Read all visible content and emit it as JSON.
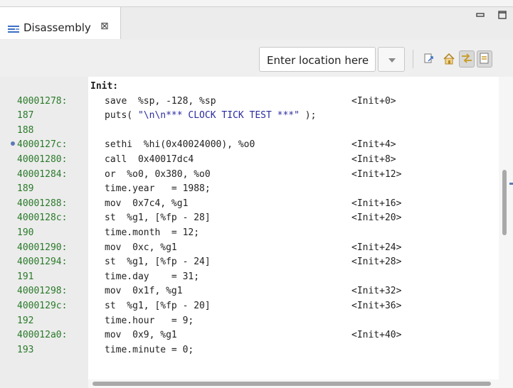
{
  "tab": {
    "title": "Disassembly",
    "close_glyph": "⊠",
    "icon": "disassembly-icon"
  },
  "view_buttons": {
    "minimize": "▭",
    "maximize": "▭"
  },
  "toolbar": {
    "location_placeholder": "Enter location here",
    "buttons": [
      "go-to-address-icon",
      "home-icon",
      "link-with-debug-icon",
      "show-source-icon"
    ]
  },
  "lines": [
    {
      "addr": "",
      "code": "Init:",
      "kind": "label"
    },
    {
      "addr": "40001278:",
      "code": "save  %sp, -128, %sp",
      "offset": "<Init+0>"
    },
    {
      "addr": "187",
      "code_prefix": "puts( ",
      "code_str": "\"\\n\\n*** CLOCK TICK TEST ***\"",
      "code_suffix": " );",
      "kind": "source"
    },
    {
      "addr": "188",
      "code": ""
    },
    {
      "addr": "4000127c:",
      "code": "sethi  %hi(0x40024000), %o0",
      "offset": "<Init+4>",
      "breakpoint": true
    },
    {
      "addr": "40001280:",
      "code": "call  0x40017dc4",
      "offset": "<Init+8>"
    },
    {
      "addr": "40001284:",
      "code": "or  %o0, 0x380, %o0",
      "offset": "<Init+12>"
    },
    {
      "addr": "189",
      "code": "time.year   = 1988;"
    },
    {
      "addr": "40001288:",
      "code": "mov  0x7c4, %g1",
      "offset": "<Init+16>"
    },
    {
      "addr": "4000128c:",
      "code": "st  %g1, [%fp - 28]",
      "offset": "<Init+20>"
    },
    {
      "addr": "190",
      "code": "time.month  = 12;"
    },
    {
      "addr": "40001290:",
      "code": "mov  0xc, %g1",
      "offset": "<Init+24>"
    },
    {
      "addr": "40001294:",
      "code": "st  %g1, [%fp - 24]",
      "offset": "<Init+28>"
    },
    {
      "addr": "191",
      "code": "time.day    = 31;"
    },
    {
      "addr": "40001298:",
      "code": "mov  0x1f, %g1",
      "offset": "<Init+32>"
    },
    {
      "addr": "4000129c:",
      "code": "st  %g1, [%fp - 20]",
      "offset": "<Init+36>"
    },
    {
      "addr": "192",
      "code": "time.hour   = 9;"
    },
    {
      "addr": "400012a0:",
      "code": "mov  0x9, %g1",
      "offset": "<Init+40>"
    },
    {
      "addr": "193",
      "code": "time.minute = 0;"
    }
  ],
  "colors": {
    "address": "#2a7a2a",
    "string": "#2a2aa0",
    "breakpoint": "#5a7ab8"
  }
}
